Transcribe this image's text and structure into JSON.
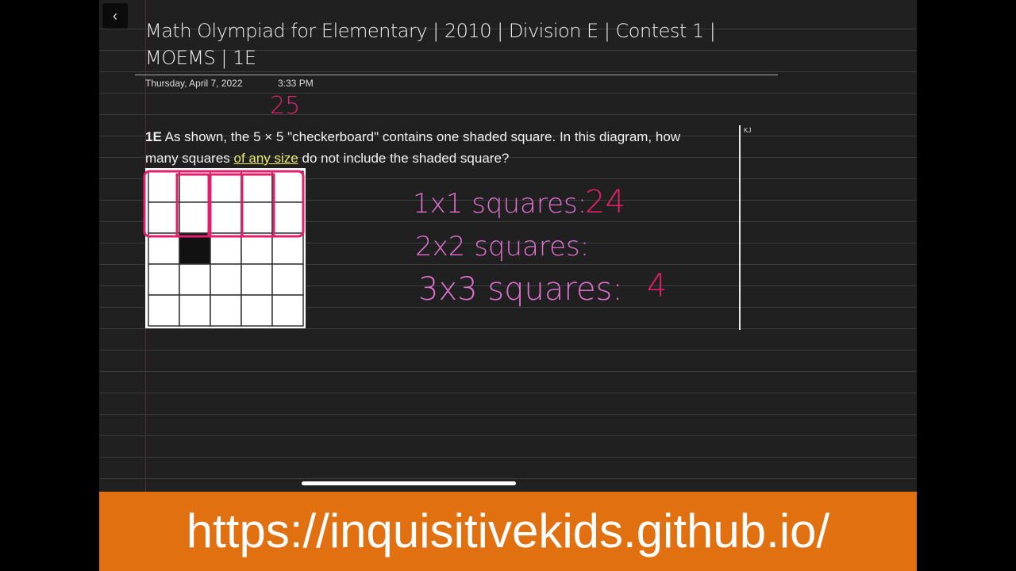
{
  "page": {
    "title": "Math Olympiad for Elementary | 2010 | Division E | Contest 1 | MOEMS | 1E",
    "date": "Thursday, April 7, 2022",
    "time": "3:33 PM",
    "author_tag": "KJ"
  },
  "problem": {
    "label": "1E",
    "text_before": " As shown, the 5 × 5 \"checkerboard\" contains one shaded square. In this diagram, how many squares ",
    "highlight": "of any size",
    "text_after": " do not include the shaded square?"
  },
  "board": {
    "rows": 5,
    "cols": 5,
    "shaded": {
      "row": 3,
      "col": 2
    }
  },
  "handwriting": {
    "total": "25",
    "line1_label": "1x1 squares:",
    "line1_value": "24",
    "line2_label": "2x2 squares:",
    "line3_label": "3x3 squares:",
    "line3_value": "4"
  },
  "colors": {
    "ink_pink": "#e040b0",
    "ink_red": "#e0206a",
    "banner": "#e07010"
  },
  "banner": {
    "url": "https://inquisitivekids.github.io/"
  }
}
